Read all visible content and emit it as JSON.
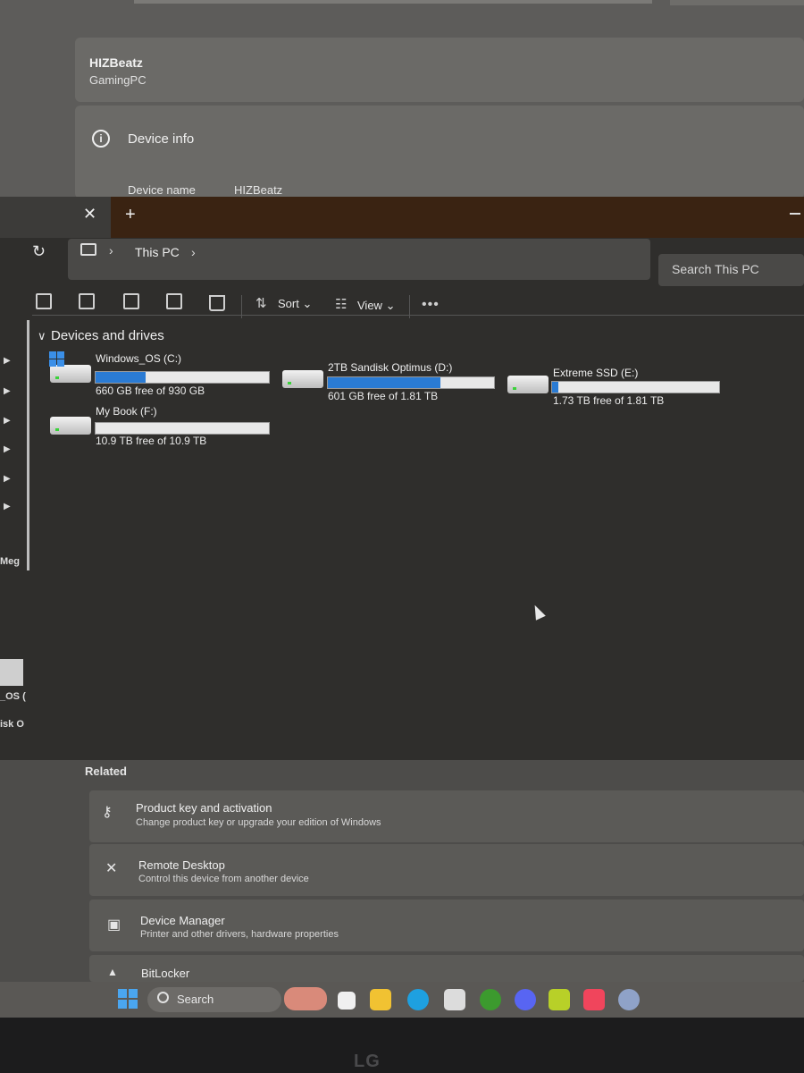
{
  "settings": {
    "user_name": "HIZBeatz",
    "pc_name": "GamingPC",
    "device_info_title": "Device info",
    "device_name_label": "Device name",
    "device_name_value": "HIZBeatz"
  },
  "explorer": {
    "tab": {
      "close_label": "✕",
      "new_tab_label": "+"
    },
    "address": {
      "crumb": "This PC",
      "search_placeholder": "Search This PC"
    },
    "toolbar": {
      "sort_label": "Sort",
      "view_label": "View",
      "more_label": "•••"
    },
    "section_title": "Devices and drives",
    "drives": [
      {
        "name": "Windows_OS (C:)",
        "free": "660 GB free of 930 GB",
        "used_fraction": 0.29,
        "icon": "os-drive-icon"
      },
      {
        "name": "2TB Sandisk Optimus  (D:)",
        "free": "601 GB free of 1.81 TB",
        "used_fraction": 0.68,
        "icon": "drive-icon"
      },
      {
        "name": "Extreme SSD (E:)",
        "free": "1.73 TB free of 1.81 TB",
        "used_fraction": 0.04,
        "icon": "drive-icon"
      },
      {
        "name": "My Book (F:)",
        "free": "10.9 TB free of 10.9 TB",
        "used_fraction": 0.0,
        "icon": "drive-icon"
      }
    ],
    "sidebar_labels": [
      "Meg",
      "_OS (",
      "isk O"
    ]
  },
  "related": {
    "title": "Related",
    "items": [
      {
        "title": "Product key and activation",
        "subtitle": "Change product key or upgrade your edition of Windows",
        "icon": "key-icon"
      },
      {
        "title": "Remote Desktop",
        "subtitle": "Control this device from another device",
        "icon": "remote-desktop-icon"
      },
      {
        "title": "Device Manager",
        "subtitle": "Printer and other drivers, hardware properties",
        "icon": "device-manager-icon"
      },
      {
        "title": "BitLocker",
        "subtitle": "",
        "icon": "lock-icon"
      }
    ]
  },
  "taskbar": {
    "search_label": "Search"
  },
  "monitor": {
    "brand": "LG"
  },
  "colors": {
    "accent": "#2a7bd4",
    "tabbar": "#3a2312"
  }
}
